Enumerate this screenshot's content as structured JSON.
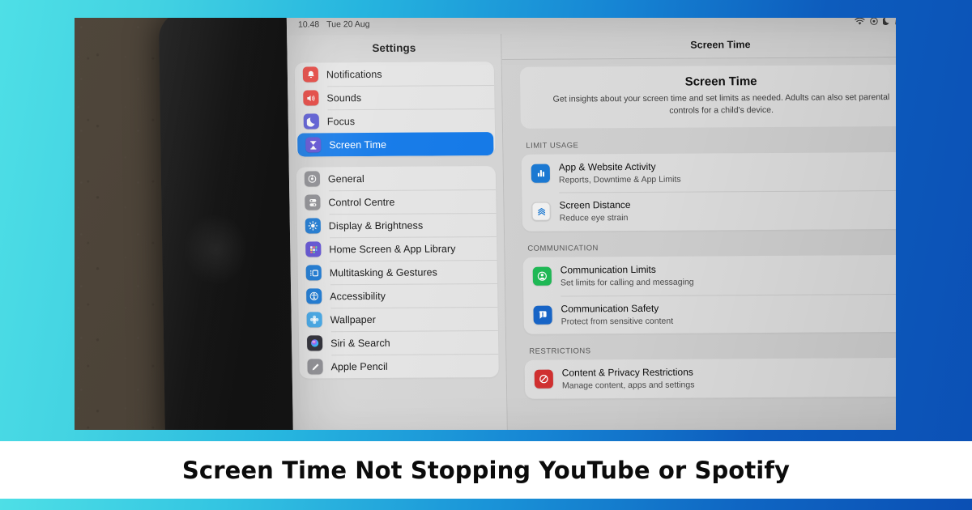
{
  "caption": {
    "text": "Screen Time Not Stopping YouTube or Spotify"
  },
  "colors": {
    "bg_left": "#4edfe6",
    "bg_right": "#0b50b5",
    "selection_blue": "#1178e8",
    "caption_band": "#ffffff"
  },
  "status_bar": {
    "time": "10.48",
    "date": "Tue 20 Aug",
    "icons": [
      "wifi-icon",
      "control-centre-icon",
      "focus-moon-icon",
      "headphones-icon",
      "battery-charging-icon"
    ]
  },
  "sidebar": {
    "title": "Settings",
    "groups": [
      {
        "items": [
          {
            "label": "Notifications",
            "icon": "notifications-bell-icon",
            "color": "#e8403a",
            "selected": false
          },
          {
            "label": "Sounds",
            "icon": "sounds-speaker-icon",
            "color": "#e8403a",
            "selected": false
          },
          {
            "label": "Focus",
            "icon": "focus-moon-icon",
            "color": "#5757d6",
            "selected": false
          },
          {
            "label": "Screen Time",
            "icon": "screen-time-hourglass-icon",
            "color": "#5f4fd6",
            "selected": true
          }
        ]
      },
      {
        "items": [
          {
            "label": "General",
            "icon": "general-gear-icon",
            "color": "#8e8e93",
            "selected": false
          },
          {
            "label": "Control Centre",
            "icon": "control-centre-icon",
            "color": "#8e8e93",
            "selected": false
          },
          {
            "label": "Display & Brightness",
            "icon": "brightness-sun-icon",
            "color": "#1878d4",
            "selected": false
          },
          {
            "label": "Home Screen & App Library",
            "icon": "home-screen-grid-icon",
            "color": "#5f4fd6",
            "selected": false
          },
          {
            "label": "Multitasking & Gestures",
            "icon": "multitasking-icon",
            "color": "#1878d4",
            "selected": false
          },
          {
            "label": "Accessibility",
            "icon": "accessibility-icon",
            "color": "#1878d4",
            "selected": false
          },
          {
            "label": "Wallpaper",
            "icon": "wallpaper-flower-icon",
            "color": "#41a7e8",
            "selected": false
          },
          {
            "label": "Siri & Search",
            "icon": "siri-orb-icon",
            "color": "#2b2b33",
            "selected": false
          },
          {
            "label": "Apple Pencil",
            "icon": "apple-pencil-icon",
            "color": "#8e8e93",
            "selected": false
          }
        ]
      }
    ]
  },
  "detail": {
    "nav_title": "Screen Time",
    "hero": {
      "heading": "Screen Time",
      "description": "Get insights about your screen time and set limits as needed. Adults can also set parental controls for a child's device."
    },
    "sections": [
      {
        "header": "LIMIT USAGE",
        "rows": [
          {
            "title": "App & Website Activity",
            "subtitle": "Reports, Downtime & App Limits",
            "icon": "bar-chart-icon",
            "color": "#1878d4",
            "chevron": "›"
          },
          {
            "title": "Screen Distance",
            "subtitle": "Reduce eye strain",
            "icon": "screen-distance-chevrons-icon",
            "color": "#f2f2f2",
            "chevron": "›"
          }
        ]
      },
      {
        "header": "COMMUNICATION",
        "rows": [
          {
            "title": "Communication Limits",
            "subtitle": "Set limits for calling and messaging",
            "icon": "communication-limits-person-icon",
            "color": "#1db954",
            "chevron": "›"
          },
          {
            "title": "Communication Safety",
            "subtitle": "Protect from sensitive content",
            "icon": "communication-safety-bubble-icon",
            "color": "#1564c8",
            "chevron": "›"
          }
        ]
      },
      {
        "header": "RESTRICTIONS",
        "rows": [
          {
            "title": "Content & Privacy Restrictions",
            "subtitle": "Manage content, apps and settings",
            "icon": "restrictions-prohibition-icon",
            "color": "#d22f2f",
            "chevron": "›"
          }
        ]
      }
    ]
  }
}
